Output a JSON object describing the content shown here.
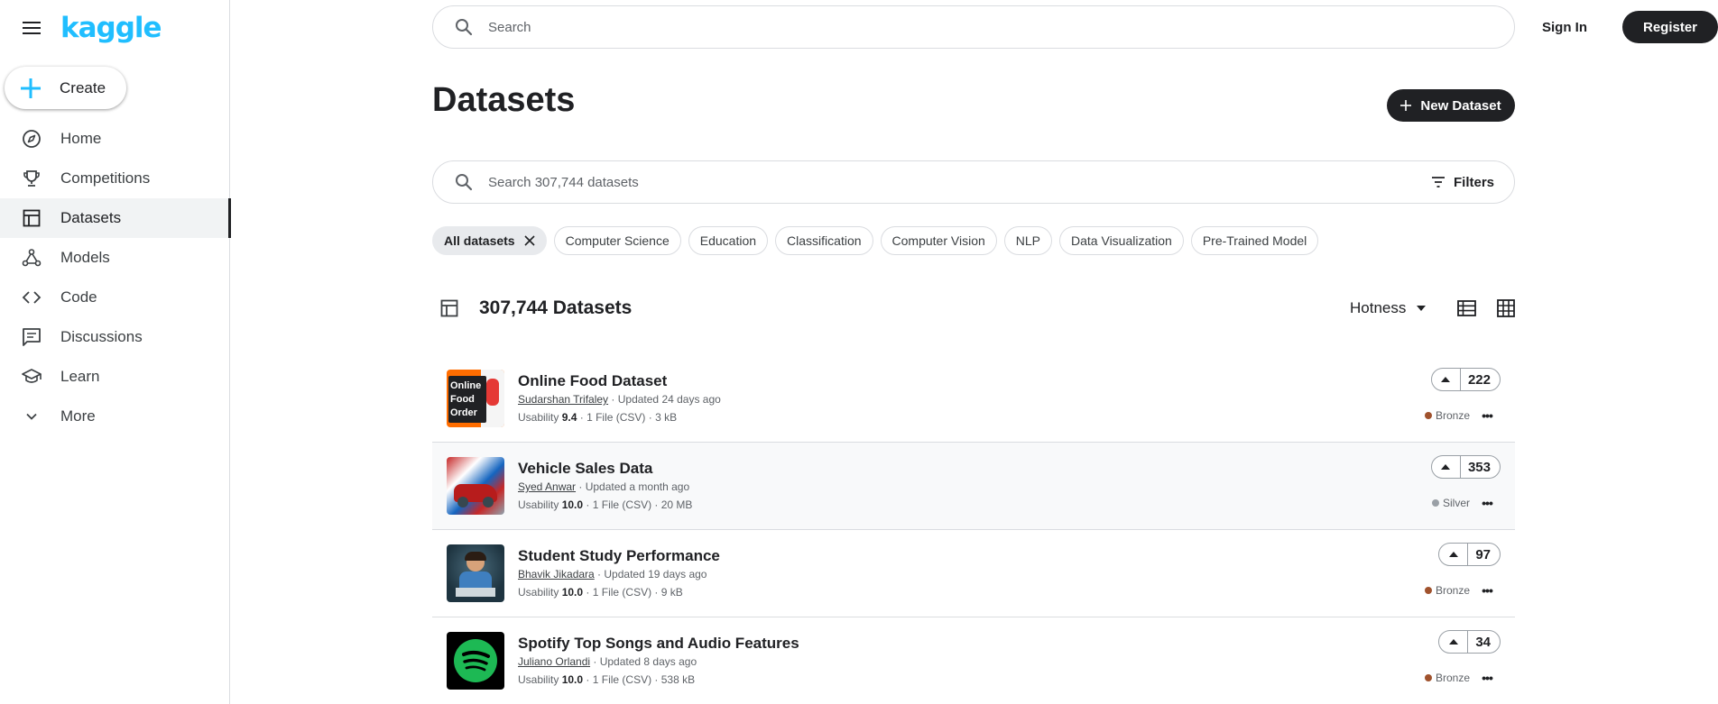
{
  "brand": {
    "logo_text": "kaggle"
  },
  "sidebar": {
    "create_label": "Create",
    "items": [
      {
        "label": "Home",
        "icon": "compass-icon"
      },
      {
        "label": "Competitions",
        "icon": "trophy-icon"
      },
      {
        "label": "Datasets",
        "icon": "table-icon",
        "active": true
      },
      {
        "label": "Models",
        "icon": "models-icon"
      },
      {
        "label": "Code",
        "icon": "code-icon"
      },
      {
        "label": "Discussions",
        "icon": "discussion-icon"
      },
      {
        "label": "Learn",
        "icon": "school-icon"
      },
      {
        "label": "More",
        "icon": "chevron-down-icon"
      }
    ]
  },
  "header": {
    "search_placeholder": "Search",
    "signin_label": "Sign In",
    "register_label": "Register"
  },
  "main": {
    "title": "Datasets",
    "new_dataset_label": "New Dataset",
    "dataset_search_placeholder": "Search 307,744 datasets",
    "filters_label": "Filters",
    "chips": [
      "All datasets",
      "Computer Science",
      "Education",
      "Classification",
      "Computer Vision",
      "NLP",
      "Data Visualization",
      "Pre-Trained Model"
    ],
    "count_label": "307,744 Datasets",
    "sort_label": "Hotness",
    "datasets": [
      {
        "title": "Online Food Dataset",
        "author": "Sudarshan Trifaley",
        "updated": "Updated 24 days ago",
        "usability_label": "Usability",
        "usability": "9.4",
        "files": "1 File (CSV)",
        "size": "3 kB",
        "votes": "222",
        "medal": "Bronze",
        "medal_color": "#a0522d",
        "thumb_text": "Online Food Order"
      },
      {
        "title": "Vehicle Sales Data",
        "author": "Syed Anwar",
        "updated": "Updated a month ago",
        "usability_label": "Usability",
        "usability": "10.0",
        "files": "1 File (CSV)",
        "size": "20 MB",
        "votes": "353",
        "medal": "Silver",
        "medal_color": "#9aa0a6"
      },
      {
        "title": "Student Study Performance",
        "author": "Bhavik Jikadara",
        "updated": "Updated 19 days ago",
        "usability_label": "Usability",
        "usability": "10.0",
        "files": "1 File (CSV)",
        "size": "9 kB",
        "votes": "97",
        "medal": "Bronze",
        "medal_color": "#a0522d"
      },
      {
        "title": "Spotify Top Songs and Audio Features",
        "author": "Juliano Orlandi",
        "updated": "Updated 8 days ago",
        "usability_label": "Usability",
        "usability": "10.0",
        "files": "1 File (CSV)",
        "size": "538 kB",
        "votes": "34",
        "medal": "Bronze",
        "medal_color": "#a0522d"
      }
    ]
  },
  "colors": {
    "brand": "#20BEFF",
    "dark": "#202124",
    "spotify": "#1DB954"
  }
}
